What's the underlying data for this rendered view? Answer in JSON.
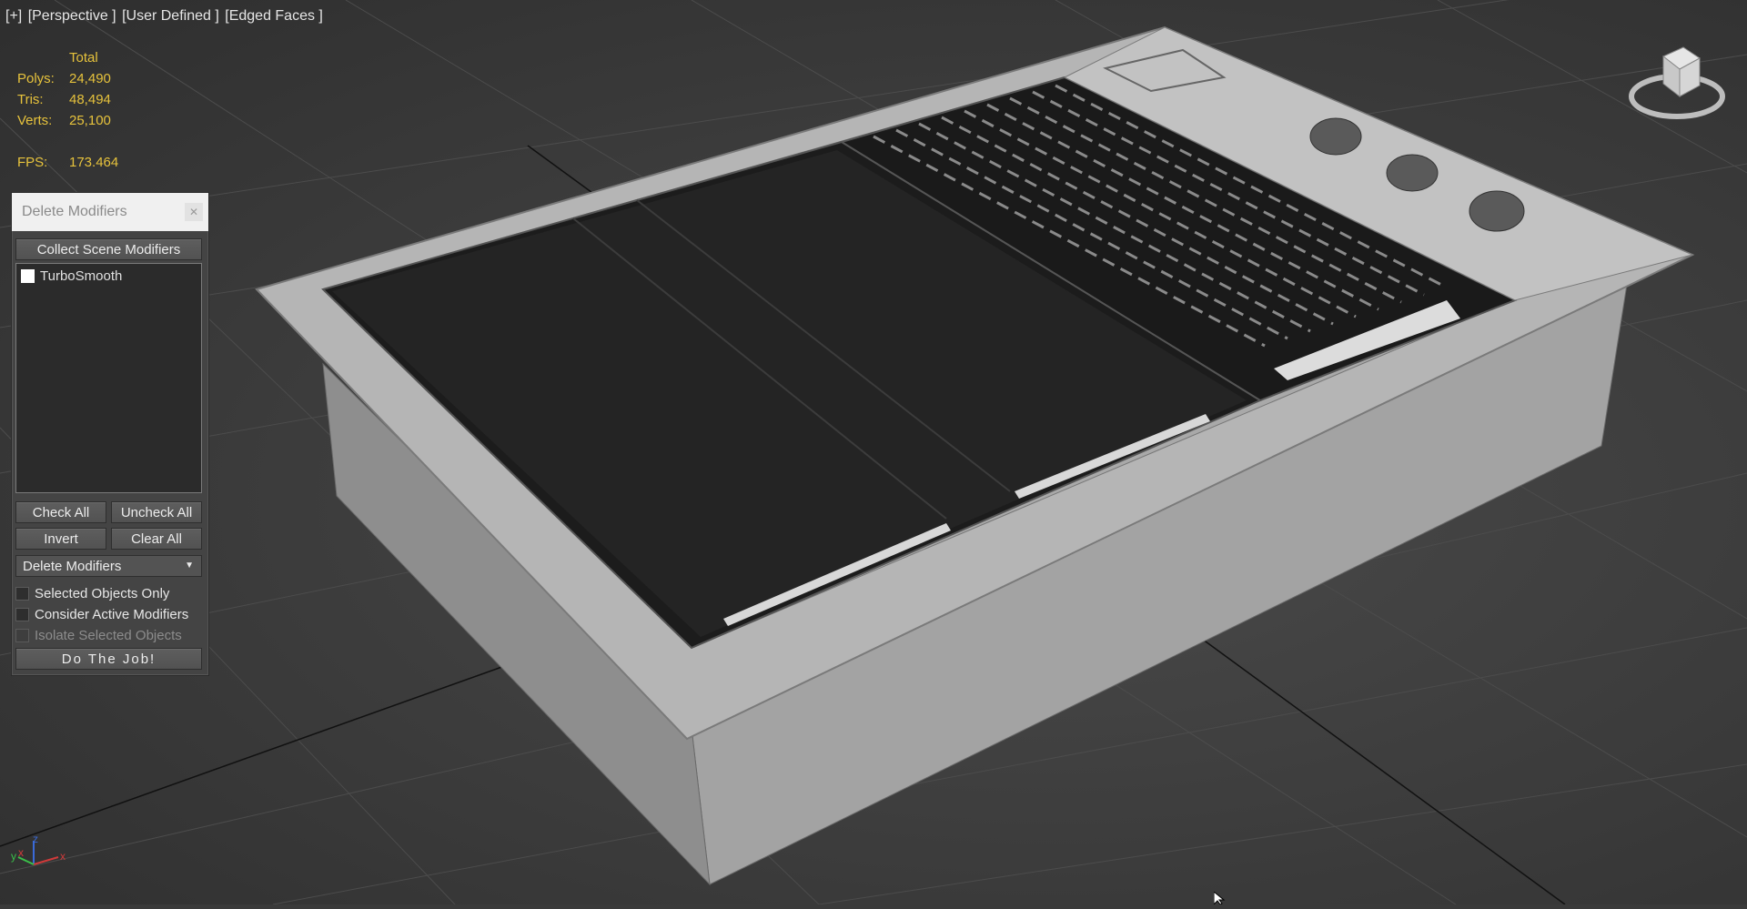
{
  "viewport": {
    "labels": [
      "[+]",
      "[Perspective ]",
      "[User Defined ]",
      "[Edged Faces ]"
    ]
  },
  "stats": {
    "header": "Total",
    "polys_label": "Polys:",
    "polys": "24,490",
    "tris_label": "Tris:",
    "tris": "48,494",
    "verts_label": "Verts:",
    "verts": "25,100",
    "fps_label": "FPS:",
    "fps": "173.464"
  },
  "panel": {
    "title": "Delete Modifiers",
    "close_icon": "close-icon",
    "collect_button": "Collect Scene Modifiers",
    "modifiers": [
      {
        "label": "TurboSmooth",
        "checked": false
      }
    ],
    "check_all": "Check All",
    "uncheck_all": "Uncheck All",
    "invert": "Invert",
    "clear_all": "Clear All",
    "action_select": "Delete Modifiers",
    "option_selected_only": "Selected Objects Only",
    "option_active_modifiers": "Consider Active Modifiers",
    "option_isolate": "Isolate Selected Objects",
    "do_job": "Do The Job!"
  },
  "axis": {
    "x": "x",
    "y": "y",
    "z": "z"
  },
  "colors": {
    "stats": "#e6c23c",
    "axis_x": "#d03a3a",
    "axis_y": "#3ac04a",
    "axis_z": "#3a6ad8"
  }
}
